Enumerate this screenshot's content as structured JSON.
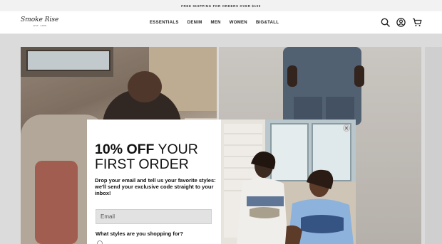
{
  "promo": {
    "text": "FREE SHIPPING FOR ORDERS OVER $100"
  },
  "header": {
    "logo_text": "Smoke Rise",
    "logo_subtext": "EST. 2006",
    "nav": [
      "ESSENTIALS",
      "DENIM",
      "MEN",
      "WOMEN",
      "BIG&TALL"
    ]
  },
  "popup": {
    "headline_bold": "10% OFF",
    "headline_rest": " YOUR FIRST ORDER",
    "body": "Drop your email and tell us your favorite styles: we'll send your exclusive code straight to your inbox!",
    "email_placeholder": "Email",
    "styles_question": "What styles are you shopping for?"
  },
  "colors": {
    "accent": "#111111",
    "promo_bg": "#f2f2f2",
    "input_bg": "#e2e2e2"
  },
  "icons": [
    "search-icon",
    "account-icon",
    "cart-icon",
    "close-icon"
  ]
}
